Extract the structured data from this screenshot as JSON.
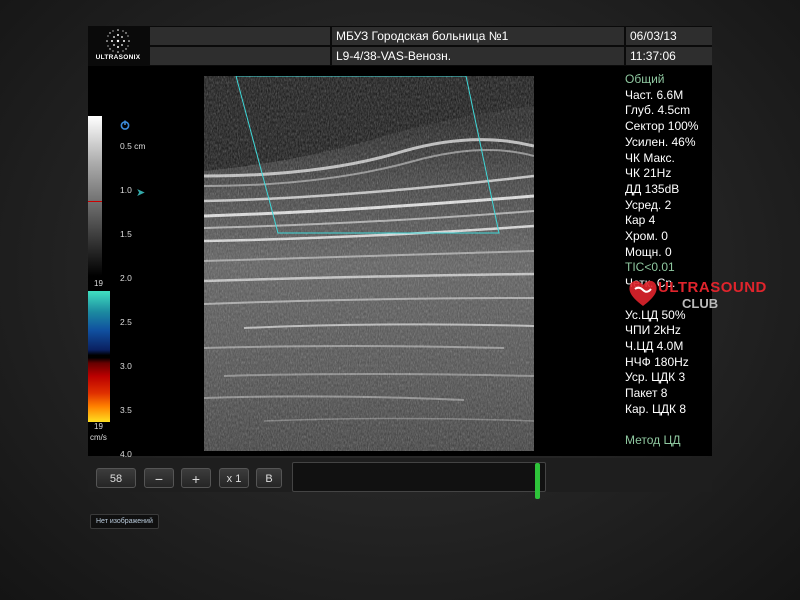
{
  "header": {
    "logo_text": "ULTRASONIX",
    "institution": "МБУЗ Городская больница №1",
    "probe_preset": "L9-4/38-VAS-Венозн.",
    "date": "06/03/13",
    "time": "11:37:06"
  },
  "scale": {
    "velocity_top": "19",
    "velocity_bottom": "19",
    "units": "cm/s",
    "depth_marks": [
      "0.5 cm",
      "1.0",
      "1.5",
      "2.0",
      "2.5",
      "3.0",
      "3.5",
      "4.0"
    ]
  },
  "params": [
    {
      "text": "Общий",
      "accent": true
    },
    {
      "text": "Част. 6.6M",
      "accent": false
    },
    {
      "text": "Глуб. 4.5cm",
      "accent": false
    },
    {
      "text": "Сектор 100%",
      "accent": false
    },
    {
      "text": "Усилен. 46%",
      "accent": false
    },
    {
      "text": "ЧК Макс.",
      "accent": false
    },
    {
      "text": "ЧК  21Hz",
      "accent": false
    },
    {
      "text": "ДД 135dB",
      "accent": false
    },
    {
      "text": "Усред. 2",
      "accent": false
    },
    {
      "text": "Кар 4",
      "accent": false
    },
    {
      "text": "Хром. 0",
      "accent": false
    },
    {
      "text": "Мощн. 0",
      "accent": false
    },
    {
      "text": "TIC<0.01",
      "accent": true
    },
    {
      "text": "Четк. Ср.",
      "accent": false
    },
    {
      "text": "",
      "accent": false
    },
    {
      "text": "Ус.ЦД 50%",
      "accent": false
    },
    {
      "text": "ЧПИ 2kHz",
      "accent": false
    },
    {
      "text": "Ч.ЦД 4.0M",
      "accent": false
    },
    {
      "text": "НЧФ 180Hz",
      "accent": false
    },
    {
      "text": "Уср. ЦДК 3",
      "accent": false
    },
    {
      "text": "Пакет 8",
      "accent": false
    },
    {
      "text": "Кар. ЦДК 8",
      "accent": false
    }
  ],
  "method_label": "Метод ЦД",
  "watermark": {
    "line1": "ULTRASOUND",
    "line2": "CLUB"
  },
  "toolbar": {
    "frame_value": "58",
    "minus_label": "−",
    "plus_label": "+",
    "speed_label": "x 1",
    "mode_label": "B",
    "slider_position": 0.98
  },
  "status": {
    "no_images": "Нет изображений"
  },
  "colors": {
    "accent_green": "#8fc8a0",
    "roi_cyan": "#3fd8d8",
    "slider_green": "#2ec43a",
    "watermark_red": "#e0242c"
  }
}
